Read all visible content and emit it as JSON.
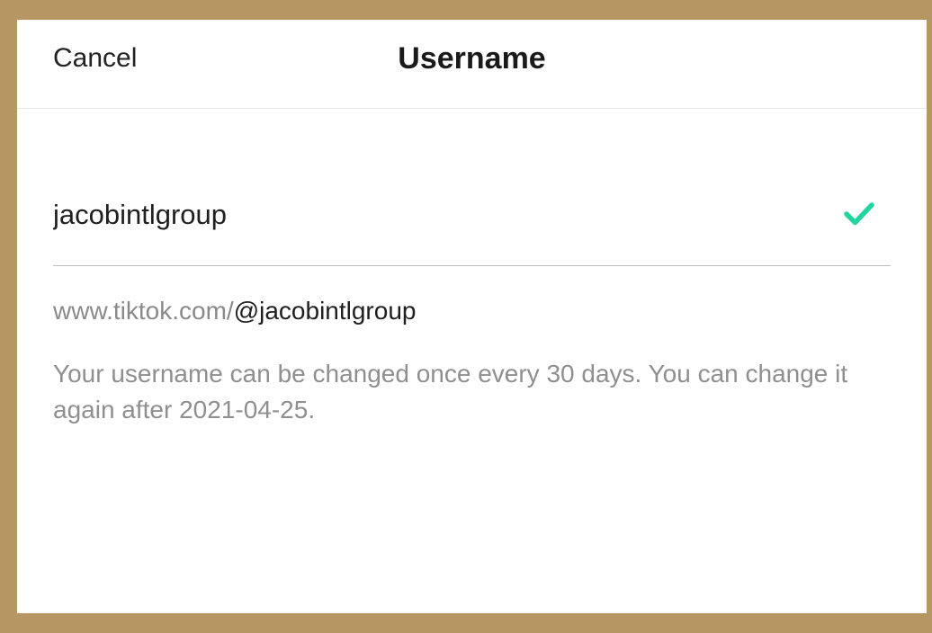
{
  "header": {
    "cancel_label": "Cancel",
    "title": "Username"
  },
  "username_field": {
    "value": "jacobintlgroup",
    "status_icon": "check-icon",
    "status_color": "#20d5a0"
  },
  "profile_url": {
    "prefix": "www.tiktok.com/",
    "handle": "@jacobintlgroup"
  },
  "notice": {
    "text": "Your username can be changed once every 30 days. You can change it again after 2021-04-25."
  },
  "colors": {
    "frame_border": "#b69763",
    "background": "#ffffff",
    "accent_check": "#20d5a0"
  }
}
